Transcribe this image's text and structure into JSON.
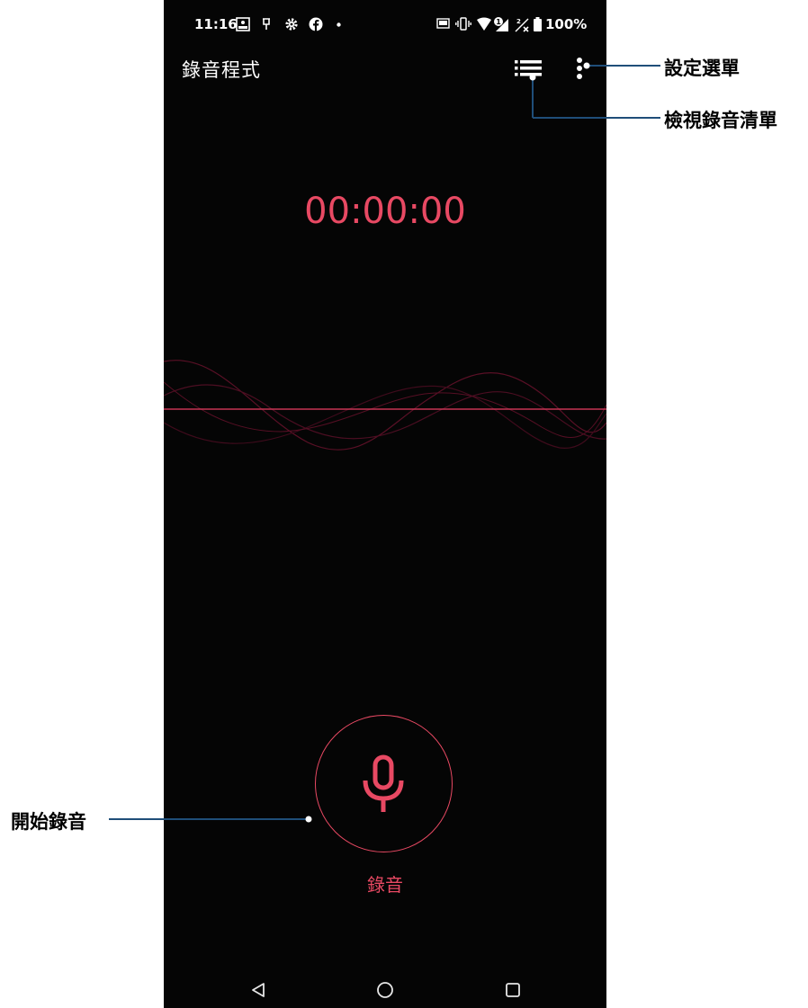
{
  "status_bar": {
    "time": "11:16",
    "battery": "100%",
    "icons": [
      "rec-icon",
      "pushpin-icon",
      "gear-icon",
      "facebook-icon",
      "dot-icon",
      "auto-brightness-icon",
      "vibrate-icon",
      "wifi-icon",
      "signal-icon",
      "no-signal-icon",
      "battery-icon"
    ]
  },
  "app": {
    "title": "錄音程式",
    "toolbar_icons": [
      "list-icon",
      "more-vert-icon"
    ]
  },
  "timer": {
    "value": "00:00:00"
  },
  "record": {
    "label": "錄音",
    "icon": "microphone-icon"
  },
  "nav_bar": {
    "icons": [
      "back-icon",
      "home-icon",
      "recents-icon"
    ]
  },
  "callouts": {
    "settings_menu": "設定選單",
    "view_recordings": "檢視錄音清單",
    "start_recording": "開始錄音"
  },
  "colors": {
    "accent": "#e84963",
    "background": "#050505",
    "callout_line": "#1f4e79"
  }
}
